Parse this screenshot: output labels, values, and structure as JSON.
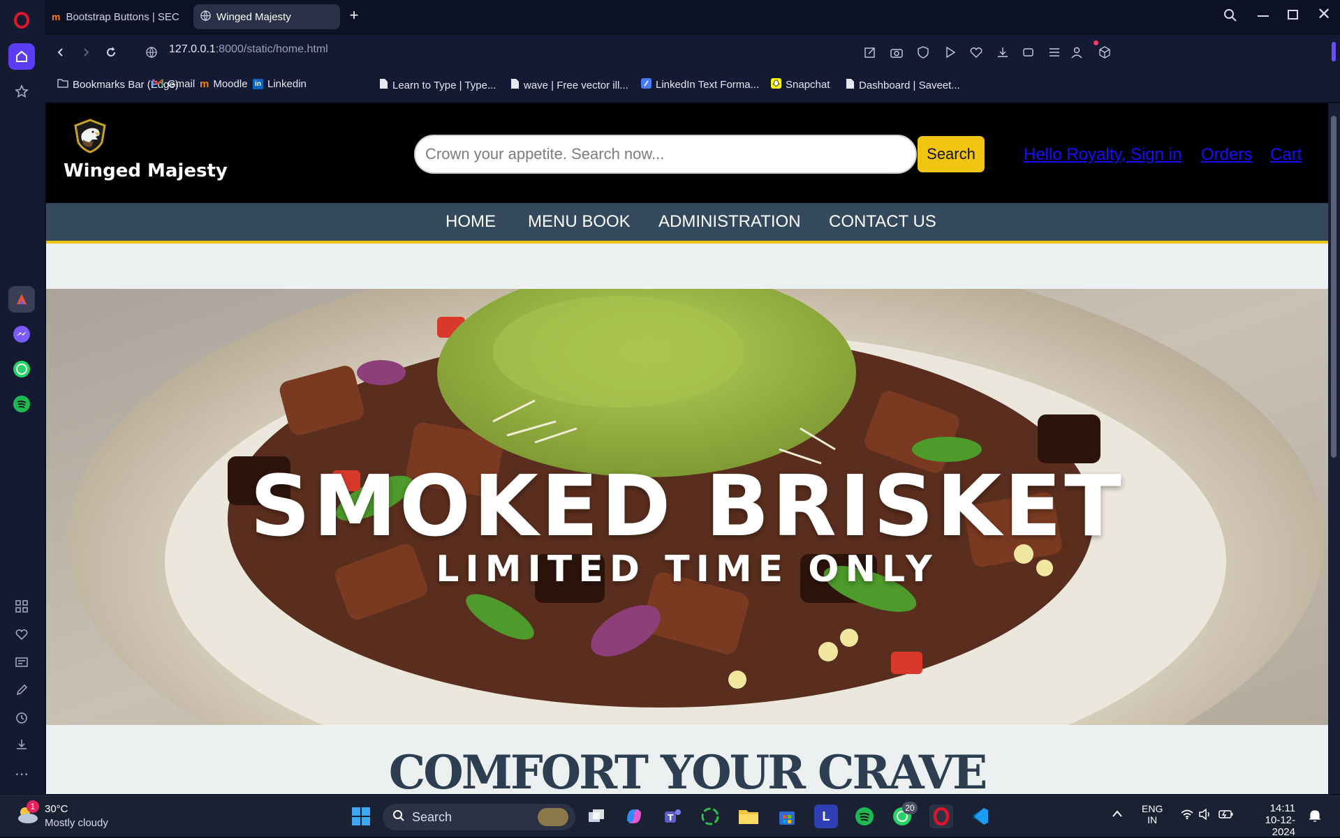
{
  "browser": {
    "tabs": [
      {
        "label": "Bootstrap Buttons | SEC",
        "active": false
      },
      {
        "label": "Winged Majesty",
        "active": true
      }
    ],
    "url_host": "127.0.0.1",
    "url_rest": ":8000/static/home.html",
    "bookmarks": [
      {
        "label": "Bookmarks Bar (Edge)",
        "icon": "folder-icon"
      },
      {
        "label": "Gmail",
        "icon": "gmail-icon"
      },
      {
        "label": "Moodle",
        "icon": "moodle-icon"
      },
      {
        "label": "Linkedin",
        "icon": "linkedin-icon"
      },
      {
        "label": "Learn to Type | Type...",
        "icon": "page-icon"
      },
      {
        "label": "wave | Free vector ill...",
        "icon": "page-icon"
      },
      {
        "label": "LinkedIn Text Forma...",
        "icon": "page-icon"
      },
      {
        "label": "Snapchat",
        "icon": "snapchat-icon"
      },
      {
        "label": "Dashboard | Saveet...",
        "icon": "page-icon"
      }
    ]
  },
  "site": {
    "brand": "Winged Majesty",
    "search_placeholder": "Crown your appetite. Search now...",
    "search_button": "Search",
    "header_links": {
      "signin": "Hello Royalty, Sign in",
      "orders": "Orders",
      "cart": "Cart"
    },
    "nav": [
      "HOME",
      "MENU BOOK",
      "ADMINISTRATION",
      "CONTACT US"
    ],
    "hero": {
      "title": "SMOKED BRISKET",
      "subtitle": "LIMITED TIME ONLY"
    },
    "section_heading": "COMFORT YOUR CRAVE",
    "colors": {
      "header_bg": "#000000",
      "nav_bg": "#34495e",
      "accent": "#f1c40f",
      "heading": "#2c3e50"
    }
  },
  "taskbar": {
    "weather_temp": "30°C",
    "weather_desc": "Mostly cloudy",
    "weather_badge": "1",
    "search_label": "Search",
    "whatsapp_badge": "20",
    "lang_top": "ENG",
    "lang_bottom": "IN",
    "time": "14:11",
    "date": "10-12-2024"
  }
}
